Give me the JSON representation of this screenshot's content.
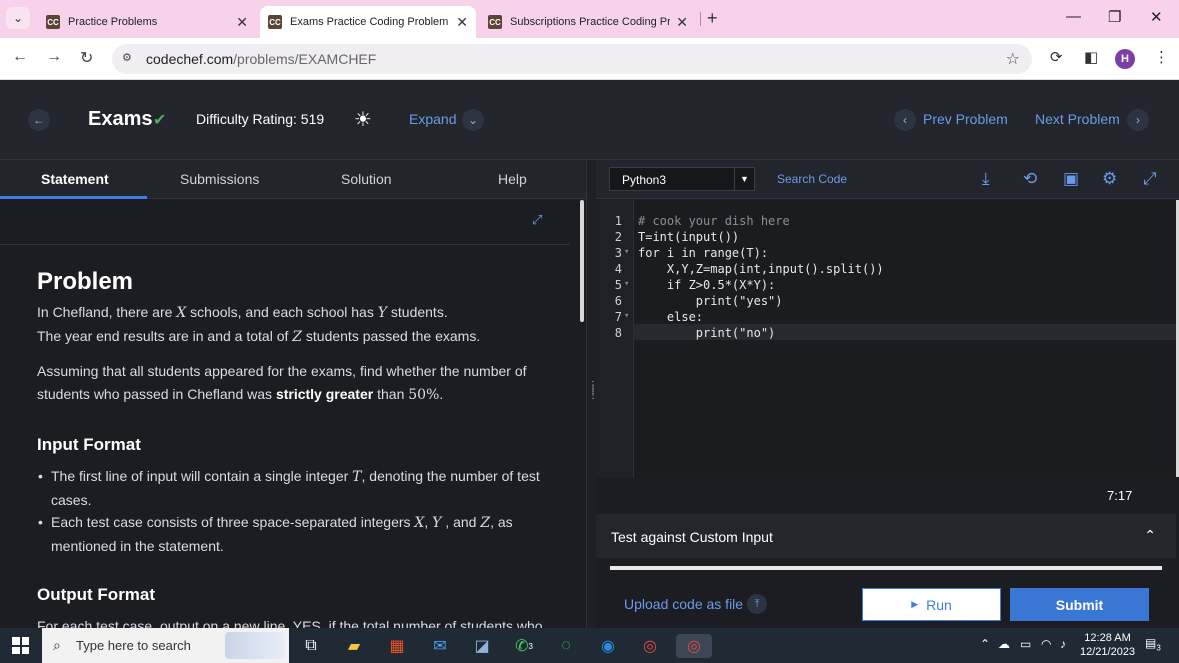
{
  "browser": {
    "tabs": [
      {
        "title": "Practice Problems",
        "favicon": "CC",
        "active": false
      },
      {
        "title": "Exams Practice Coding Problem - C",
        "favicon": "CC",
        "active": true
      },
      {
        "title": "Subscriptions Practice Coding Pro",
        "favicon": "CC",
        "active": false
      }
    ],
    "url_host": "codechef.com",
    "url_path": "/problems/EXAMCHEF",
    "profile_initial": "H",
    "icons": [
      "tab-search-icon",
      "close-icon",
      "new-tab-icon",
      "minimize-icon",
      "restore-icon",
      "back-icon",
      "forward-icon",
      "reload-icon",
      "site-info-icon",
      "star-icon",
      "extension-icon",
      "sidepanel-icon",
      "kebab-icon"
    ]
  },
  "header": {
    "title": "Exams",
    "difficulty": "Difficulty Rating: 519",
    "expand": "Expand",
    "prev": "Prev Problem",
    "next": "Next Problem"
  },
  "left_tabs": [
    "Statement",
    "Submissions",
    "Solution",
    "Help"
  ],
  "statement": {
    "problem_heading": "Problem",
    "line1_a": "In Chefland, there are ",
    "line1_x": "X",
    "line1_b": " schools, and each school has ",
    "line1_y": "Y",
    "line1_c": " students.",
    "line2_a": "The year end results are in and a total of ",
    "line2_z": "Z",
    "line2_b": " students passed the exams.",
    "para2_a": "Assuming that all students appeared for the exams, find whether the number of students who passed in Chefland was ",
    "para2_bold": "strictly greater",
    "para2_b": " than ",
    "para2_pct": "50%",
    "para2_c": ".",
    "input_heading": "Input Format",
    "bullet1_a": "The first line of input will contain a single integer ",
    "bullet1_t": "T",
    "bullet1_b": ", denoting the number of test cases.",
    "bullet2_a": "Each test case consists of three space-separated integers ",
    "bullet2_x": "X",
    "bullet2_sep1": ", ",
    "bullet2_y": "Y",
    "bullet2_sep2": " , and ",
    "bullet2_z": "Z",
    "bullet2_b": ", as mentioned in the statement.",
    "output_heading": "Output Format",
    "output_line": "For each test case, output on a new line, YES, if the total number of students who"
  },
  "editor": {
    "language": "Python3",
    "search": "Search Code",
    "lines": [
      {
        "n": "1",
        "code": "# cook your dish here"
      },
      {
        "n": "2",
        "code": "T=int(input())"
      },
      {
        "n": "3",
        "code": "for i in range(T):"
      },
      {
        "n": "4",
        "code": "    X,Y,Z=map(int,input().split())"
      },
      {
        "n": "5",
        "code": "    if Z>0.5*(X*Y):"
      },
      {
        "n": "6",
        "code": "        print(\"yes\")"
      },
      {
        "n": "7",
        "code": "    else:"
      },
      {
        "n": "8",
        "code": "        print(\"no\")"
      }
    ],
    "cursor": "7:17"
  },
  "custom_input": "Test against Custom Input",
  "upload": "Upload code as file",
  "run": "Run",
  "submit": "Submit",
  "taskbar": {
    "search_placeholder": "Type here to search",
    "time": "12:28 AM",
    "date": "12/21/2023",
    "notif_count": "3",
    "whatsapp_count": "3"
  },
  "colors": {
    "accent": "#3f7de0",
    "link": "#6b9be8",
    "tabstrip": "#f7d2ea",
    "success": "#4caf50"
  }
}
